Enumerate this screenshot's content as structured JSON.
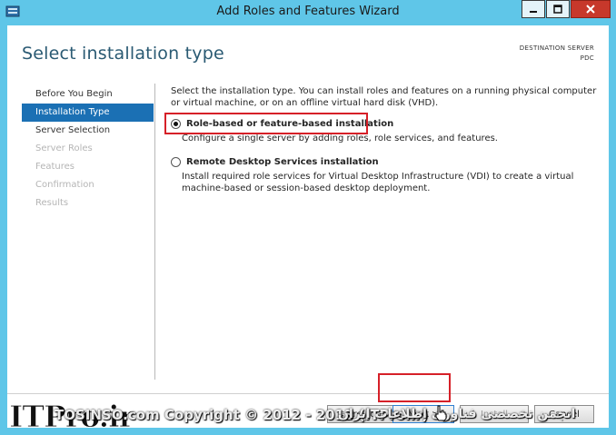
{
  "window": {
    "title": "Add Roles and Features Wizard"
  },
  "header": {
    "title": "Select installation type",
    "destination_label": "DESTINATION SERVER",
    "destination_server": "PDC"
  },
  "nav": {
    "items": [
      {
        "label": "Before You Begin",
        "state": "normal"
      },
      {
        "label": "Installation Type",
        "state": "active"
      },
      {
        "label": "Server Selection",
        "state": "normal"
      },
      {
        "label": "Server Roles",
        "state": "disabled"
      },
      {
        "label": "Features",
        "state": "disabled"
      },
      {
        "label": "Confirmation",
        "state": "disabled"
      },
      {
        "label": "Results",
        "state": "disabled"
      }
    ]
  },
  "content": {
    "intro": "Select the installation type. You can install roles and features on a running physical computer or virtual machine, or on an offline virtual hard disk (VHD).",
    "options": [
      {
        "label": "Role-based or feature-based installation",
        "description": "Configure a single server by adding roles, role services, and features.",
        "selected": true
      },
      {
        "label": "Remote Desktop Services installation",
        "description": "Install required role services for Virtual Desktop Infrastructure (VDI) to create a virtual machine-based or session-based desktop deployment.",
        "selected": false
      }
    ]
  },
  "buttons": {
    "previous": "< Previous",
    "next": "Next >",
    "install": "Install",
    "cancel": "Cancel"
  },
  "watermark": {
    "logo": "ITPro.ir",
    "copyright": "TOSINSO.com   Copyright © 2012 - 2013 (ITPro.ir)",
    "farsi": "انجمن تخصصی فناوری اطلاعات ایران"
  },
  "colors": {
    "titlebar": "#5fc6e8",
    "nav_active": "#1b70b4",
    "header_title": "#2a5a73",
    "highlight": "#d62028"
  }
}
